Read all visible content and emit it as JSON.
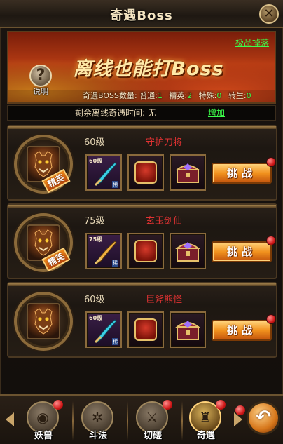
{
  "window": {
    "title": "奇遇Boss",
    "close_icon": "close-icon"
  },
  "banner": {
    "heading": "离线也能打Boss",
    "drop_link": "极品掉落",
    "help_label": "说明",
    "help_icon": "question-icon",
    "stats": {
      "label": "奇遇BOSS数量:",
      "normal_label": "普通:",
      "normal_value": "1",
      "elite_label": "精英:",
      "elite_value": "2",
      "special_label": "特殊:",
      "special_value": "0",
      "rebirth_label": "转生:",
      "rebirth_value": "0"
    }
  },
  "offline": {
    "label": "剩余离线奇遇时间: 无",
    "add_link": "增加"
  },
  "bosses": [
    {
      "level": "60级",
      "name": "守护刀将",
      "elite": true,
      "elite_label": "精英",
      "weapon_level": "60级",
      "weapon_tag": "稀",
      "challenge_label": "挑战"
    },
    {
      "level": "75级",
      "name": "玄玉剑仙",
      "elite": true,
      "elite_label": "精英",
      "weapon_level": "75级",
      "weapon_tag": "稀",
      "challenge_label": "挑战"
    },
    {
      "level": "60级",
      "name": "巨斧熊怪",
      "elite": false,
      "weapon_level": "60级",
      "weapon_tag": "稀",
      "challenge_label": "挑战"
    }
  ],
  "nav": [
    {
      "label": "妖兽",
      "icon": "beast-eye-icon",
      "active": false,
      "dot": true
    },
    {
      "label": "斗法",
      "icon": "gear-swords-icon",
      "active": false,
      "dot": false
    },
    {
      "label": "切磋",
      "icon": "crossed-swords-icon",
      "active": false,
      "dot": true
    },
    {
      "label": "奇遇",
      "icon": "adventure-helmet-icon",
      "active": true,
      "dot": true
    }
  ],
  "colors": {
    "accent_green": "#3cff4a",
    "boss_name_red": "#e03232",
    "button_orange": "#f1921e"
  }
}
